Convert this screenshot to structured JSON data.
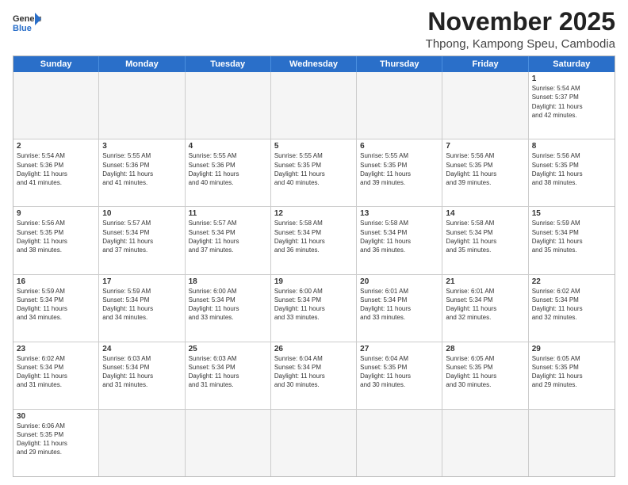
{
  "header": {
    "logo_line1": "General",
    "logo_line2": "Blue",
    "main_title": "November 2025",
    "sub_title": "Thpong, Kampong Speu, Cambodia"
  },
  "days_of_week": [
    "Sunday",
    "Monday",
    "Tuesday",
    "Wednesday",
    "Thursday",
    "Friday",
    "Saturday"
  ],
  "weeks": [
    [
      {
        "day": "",
        "info": ""
      },
      {
        "day": "",
        "info": ""
      },
      {
        "day": "",
        "info": ""
      },
      {
        "day": "",
        "info": ""
      },
      {
        "day": "",
        "info": ""
      },
      {
        "day": "",
        "info": ""
      },
      {
        "day": "1",
        "info": "Sunrise: 5:54 AM\nSunset: 5:37 PM\nDaylight: 11 hours\nand 42 minutes."
      }
    ],
    [
      {
        "day": "2",
        "info": "Sunrise: 5:54 AM\nSunset: 5:36 PM\nDaylight: 11 hours\nand 41 minutes."
      },
      {
        "day": "3",
        "info": "Sunrise: 5:55 AM\nSunset: 5:36 PM\nDaylight: 11 hours\nand 41 minutes."
      },
      {
        "day": "4",
        "info": "Sunrise: 5:55 AM\nSunset: 5:36 PM\nDaylight: 11 hours\nand 40 minutes."
      },
      {
        "day": "5",
        "info": "Sunrise: 5:55 AM\nSunset: 5:35 PM\nDaylight: 11 hours\nand 40 minutes."
      },
      {
        "day": "6",
        "info": "Sunrise: 5:55 AM\nSunset: 5:35 PM\nDaylight: 11 hours\nand 39 minutes."
      },
      {
        "day": "7",
        "info": "Sunrise: 5:56 AM\nSunset: 5:35 PM\nDaylight: 11 hours\nand 39 minutes."
      },
      {
        "day": "8",
        "info": "Sunrise: 5:56 AM\nSunset: 5:35 PM\nDaylight: 11 hours\nand 38 minutes."
      }
    ],
    [
      {
        "day": "9",
        "info": "Sunrise: 5:56 AM\nSunset: 5:35 PM\nDaylight: 11 hours\nand 38 minutes."
      },
      {
        "day": "10",
        "info": "Sunrise: 5:57 AM\nSunset: 5:34 PM\nDaylight: 11 hours\nand 37 minutes."
      },
      {
        "day": "11",
        "info": "Sunrise: 5:57 AM\nSunset: 5:34 PM\nDaylight: 11 hours\nand 37 minutes."
      },
      {
        "day": "12",
        "info": "Sunrise: 5:58 AM\nSunset: 5:34 PM\nDaylight: 11 hours\nand 36 minutes."
      },
      {
        "day": "13",
        "info": "Sunrise: 5:58 AM\nSunset: 5:34 PM\nDaylight: 11 hours\nand 36 minutes."
      },
      {
        "day": "14",
        "info": "Sunrise: 5:58 AM\nSunset: 5:34 PM\nDaylight: 11 hours\nand 35 minutes."
      },
      {
        "day": "15",
        "info": "Sunrise: 5:59 AM\nSunset: 5:34 PM\nDaylight: 11 hours\nand 35 minutes."
      }
    ],
    [
      {
        "day": "16",
        "info": "Sunrise: 5:59 AM\nSunset: 5:34 PM\nDaylight: 11 hours\nand 34 minutes."
      },
      {
        "day": "17",
        "info": "Sunrise: 5:59 AM\nSunset: 5:34 PM\nDaylight: 11 hours\nand 34 minutes."
      },
      {
        "day": "18",
        "info": "Sunrise: 6:00 AM\nSunset: 5:34 PM\nDaylight: 11 hours\nand 33 minutes."
      },
      {
        "day": "19",
        "info": "Sunrise: 6:00 AM\nSunset: 5:34 PM\nDaylight: 11 hours\nand 33 minutes."
      },
      {
        "day": "20",
        "info": "Sunrise: 6:01 AM\nSunset: 5:34 PM\nDaylight: 11 hours\nand 33 minutes."
      },
      {
        "day": "21",
        "info": "Sunrise: 6:01 AM\nSunset: 5:34 PM\nDaylight: 11 hours\nand 32 minutes."
      },
      {
        "day": "22",
        "info": "Sunrise: 6:02 AM\nSunset: 5:34 PM\nDaylight: 11 hours\nand 32 minutes."
      }
    ],
    [
      {
        "day": "23",
        "info": "Sunrise: 6:02 AM\nSunset: 5:34 PM\nDaylight: 11 hours\nand 31 minutes."
      },
      {
        "day": "24",
        "info": "Sunrise: 6:03 AM\nSunset: 5:34 PM\nDaylight: 11 hours\nand 31 minutes."
      },
      {
        "day": "25",
        "info": "Sunrise: 6:03 AM\nSunset: 5:34 PM\nDaylight: 11 hours\nand 31 minutes."
      },
      {
        "day": "26",
        "info": "Sunrise: 6:04 AM\nSunset: 5:34 PM\nDaylight: 11 hours\nand 30 minutes."
      },
      {
        "day": "27",
        "info": "Sunrise: 6:04 AM\nSunset: 5:35 PM\nDaylight: 11 hours\nand 30 minutes."
      },
      {
        "day": "28",
        "info": "Sunrise: 6:05 AM\nSunset: 5:35 PM\nDaylight: 11 hours\nand 30 minutes."
      },
      {
        "day": "29",
        "info": "Sunrise: 6:05 AM\nSunset: 5:35 PM\nDaylight: 11 hours\nand 29 minutes."
      }
    ],
    [
      {
        "day": "30",
        "info": "Sunrise: 6:06 AM\nSunset: 5:35 PM\nDaylight: 11 hours\nand 29 minutes."
      },
      {
        "day": "",
        "info": ""
      },
      {
        "day": "",
        "info": ""
      },
      {
        "day": "",
        "info": ""
      },
      {
        "day": "",
        "info": ""
      },
      {
        "day": "",
        "info": ""
      },
      {
        "day": "",
        "info": ""
      }
    ]
  ]
}
